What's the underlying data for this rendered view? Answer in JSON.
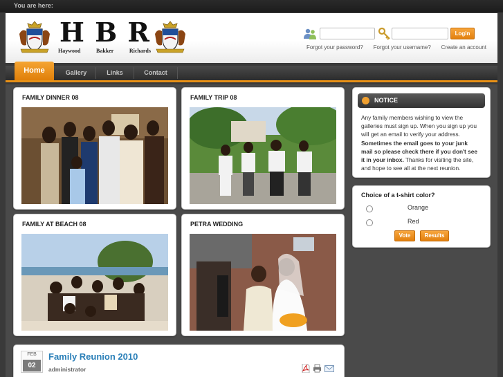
{
  "breadcrumb": {
    "label": "You are here:"
  },
  "logo": {
    "letters": [
      "H",
      "B",
      "R"
    ],
    "names": [
      "Haywood",
      "Bakker",
      "Richards"
    ]
  },
  "login": {
    "button_label": "Login",
    "forgot_password": "Forgot your password?",
    "forgot_username": "Forgot your username?",
    "create_account": "Create an account"
  },
  "nav": {
    "items": [
      {
        "label": "Home"
      },
      {
        "label": "Gallery"
      },
      {
        "label": "Links"
      },
      {
        "label": "Contact"
      }
    ]
  },
  "galleries": [
    {
      "title": "FAMILY DINNER 08"
    },
    {
      "title": "FAMILY TRIP 08"
    },
    {
      "title": "FAMILY AT BEACH 08"
    },
    {
      "title": "PETRA WEDDING"
    }
  ],
  "notice": {
    "title": "NOTICE",
    "lines": [
      "Any family members wishing to view the",
      "galleries must sign up.  When you sign up you",
      "will get an email to verify your address.",
      "Sometimes the email goes to your junk",
      "mail so please check there if you don't see",
      "it in your inbox.",
      "  Thanks for visiting the site,",
      "and hope to see all at the next reunion."
    ]
  },
  "poll": {
    "question": "Choice of a t-shirt color?",
    "options": [
      "Orange",
      "Red"
    ],
    "vote_label": "Vote",
    "results_label": "Results"
  },
  "article": {
    "month": "FEB",
    "day": "02",
    "title": "Family Reunion 2010",
    "author": "administrator"
  },
  "colors": {
    "accent": "#e89116",
    "link": "#2a7fb8"
  }
}
